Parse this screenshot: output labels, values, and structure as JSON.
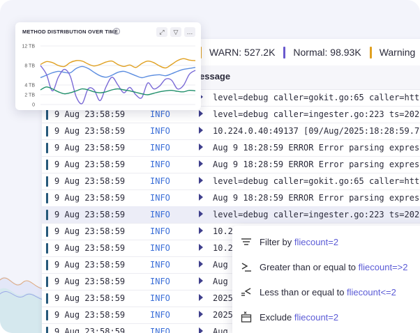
{
  "stats": [
    {
      "label": "WARN: 527.2K",
      "color": "#e0a020"
    },
    {
      "label": "Normal: 98.93K",
      "color": "#6a5acd"
    },
    {
      "label": "Warning",
      "color": "#e0a020"
    }
  ],
  "column_header": "essage",
  "rows": [
    {
      "ts": "9 Aug 23:58:59",
      "level": "INFO",
      "msg": "level=debug caller=gokit.go:65 caller=htt"
    },
    {
      "ts": "9 Aug 23:58:59",
      "level": "INFO",
      "msg": "level=debug caller=ingester.go:223 ts=202"
    },
    {
      "ts": "9 Aug 23:58:59",
      "level": "INFO",
      "msg": "10.224.0.40:49137 [09/Aug/2025:18:28:59.7"
    },
    {
      "ts": "9 Aug 23:58:59",
      "level": "INFO",
      "msg": "Aug 9 18:28:59 ERROR Error parsing expres"
    },
    {
      "ts": "9 Aug 23:58:59",
      "level": "INFO",
      "msg": "Aug 9 18:28:59 ERROR Error parsing expres"
    },
    {
      "ts": "9 Aug 23:58:59",
      "level": "INFO",
      "msg": "level=debug caller=gokit.go:65 caller=htt"
    },
    {
      "ts": "9 Aug 23:58:59",
      "level": "INFO",
      "msg": "Aug 9 18:28:59 ERROR Error parsing expres"
    },
    {
      "ts": "9 Aug 23:58:59",
      "level": "INFO",
      "msg": "level=debug caller=ingester.go:223 ts=202"
    },
    {
      "ts": "9 Aug 23:58:59",
      "level": "INFO",
      "msg": "10.2"
    },
    {
      "ts": "9 Aug 23:58:59",
      "level": "INFO",
      "msg": "10.2"
    },
    {
      "ts": "9 Aug 23:58:59",
      "level": "INFO",
      "msg": "Aug"
    },
    {
      "ts": "9 Aug 23:58:59",
      "level": "INFO",
      "msg": "Aug"
    },
    {
      "ts": "9 Aug 23:58:59",
      "level": "INFO",
      "msg": "2025"
    },
    {
      "ts": "9 Aug 23:58:59",
      "level": "INFO",
      "msg": "2025"
    },
    {
      "ts": "9 Aug 23:58:59",
      "level": "INFO",
      "msg": "Aug"
    }
  ],
  "highlighted_row": 7,
  "chart_card": {
    "title": "METHOD DISTRIBUTION OVER TIME",
    "info_icon": "info-icon",
    "controls": [
      "expand-icon",
      "filter-icon",
      "more-icon"
    ],
    "more_label": "…"
  },
  "chart_data": {
    "type": "line",
    "title": "METHOD DISTRIBUTION OVER TIME",
    "yticks": [
      "12 TB",
      "8 TB",
      "4 TB",
      "2 TB",
      "0"
    ],
    "ytick_values": [
      12,
      8,
      4,
      2,
      0
    ],
    "ylim": [
      0,
      12
    ],
    "xlabel": "",
    "ylabel": "",
    "grid": true,
    "x": [
      0,
      1,
      2,
      3,
      4,
      5,
      6,
      7,
      8,
      9,
      10,
      11,
      12,
      13,
      14,
      15,
      16,
      17,
      18,
      19,
      20,
      21,
      22,
      23,
      24,
      25,
      26
    ],
    "series": [
      {
        "color": "#e0a020",
        "values": [
          8.2,
          8.8,
          8.6,
          8.0,
          7.8,
          8.6,
          9.0,
          8.9,
          8.3,
          7.9,
          8.2,
          8.7,
          8.9,
          8.2,
          7.8,
          8.1,
          7.6,
          8.4,
          8.9,
          8.6,
          7.9,
          7.5,
          8.2,
          9.0,
          9.4,
          9.1,
          9.0
        ]
      },
      {
        "color": "#5b8de0",
        "values": [
          5.5,
          6.0,
          6.5,
          6.8,
          6.6,
          6.5,
          7.4,
          7.8,
          7.4,
          6.6,
          5.9,
          5.6,
          6.0,
          6.6,
          6.8,
          6.4,
          5.9,
          5.5,
          5.8,
          6.0,
          6.1,
          5.9,
          6.3,
          6.8,
          7.2,
          7.4,
          7.6
        ]
      },
      {
        "color": "#7a6ad6",
        "values": [
          8.0,
          6.2,
          2.8,
          5.6,
          7.2,
          5.8,
          1.6,
          0.2,
          3.2,
          3.0,
          0.8,
          3.6,
          5.6,
          4.0,
          2.4,
          3.5,
          2.0,
          1.4,
          4.4,
          3.2,
          3.8,
          5.2,
          5.0,
          3.2,
          3.9,
          6.2,
          7.0
        ]
      },
      {
        "color": "#1f8f6a",
        "values": [
          3.0,
          3.6,
          3.2,
          2.6,
          2.2,
          2.4,
          2.8,
          3.2,
          3.0,
          2.6,
          2.4,
          2.6,
          3.0,
          3.2,
          3.0,
          2.8,
          2.5,
          2.2,
          2.0,
          2.3,
          2.6,
          2.8,
          2.9,
          2.7,
          2.6,
          2.9,
          2.8
        ]
      }
    ]
  },
  "context_menu": [
    {
      "icon": "filter-lines-icon",
      "text": "Filter by ",
      "value": "fliecount=2"
    },
    {
      "icon": "greater-equal-icon",
      "text": "Greater than or equal to ",
      "value": "fliecount=>2"
    },
    {
      "icon": "less-equal-icon",
      "text": "Less than or equal to ",
      "value": "fliecount<=2"
    },
    {
      "icon": "exclude-icon",
      "text": "Exclude ",
      "value": "fliecount=2"
    }
  ]
}
